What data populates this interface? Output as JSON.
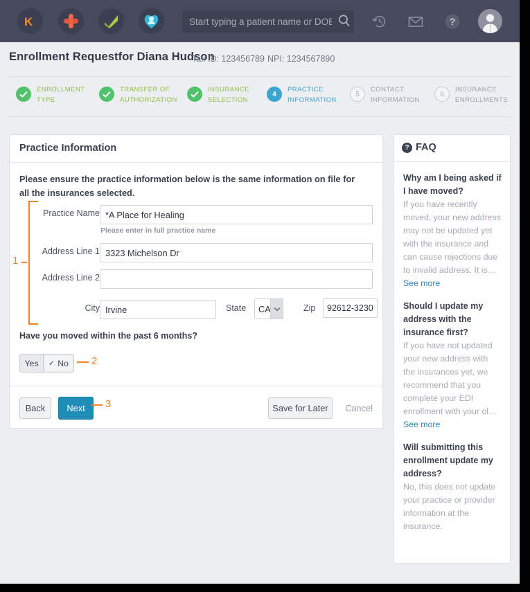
{
  "topbar": {
    "logos": [
      {
        "name": "kareo-k-logo",
        "label": "K"
      },
      {
        "name": "medical-cross-logo",
        "label": ""
      },
      {
        "name": "green-check-logo",
        "label": ""
      },
      {
        "name": "patient-heart-logo",
        "label": ""
      }
    ],
    "search": {
      "placeholder": "Start typing a patient name or DOB",
      "value": ""
    },
    "icons": [
      {
        "name": "history-icon",
        "label": "History"
      },
      {
        "name": "mail-icon",
        "label": "Messages"
      },
      {
        "name": "help-icon",
        "label": "Help"
      },
      {
        "name": "avatar",
        "label": "Account"
      }
    ]
  },
  "header": {
    "title": "Enrollment Requestfor Diana Hudson",
    "tax_id": "Tax ID: 123456789",
    "npi": "NPI: 1234567890"
  },
  "stepper": {
    "steps": [
      {
        "num": "1",
        "mark": "✓",
        "line1": "ENROLLMENT",
        "line2": "TYPE",
        "state": "done"
      },
      {
        "num": "2",
        "mark": "✓",
        "line1": "TRANSFER OF",
        "line2": "AUTHORIZATION",
        "state": "done"
      },
      {
        "num": "3",
        "mark": "✓",
        "line1": "INSURANCE",
        "line2": "SELECTION",
        "state": "done"
      },
      {
        "num": "4",
        "mark": "4",
        "line1": "PRACTICE",
        "line2": "INFORMATION",
        "state": "active"
      },
      {
        "num": "5",
        "mark": "5",
        "line1": "CONTACT",
        "line2": "INFORMATION",
        "state": "todo"
      },
      {
        "num": "6",
        "mark": "6",
        "line1": "INSURANCE",
        "line2": "ENROLLMENTS",
        "state": "todo"
      }
    ]
  },
  "main": {
    "card_title": "Practice Information",
    "intro": "Please ensure the practice information below is the same information on file for all the insurances selected.",
    "fields": {
      "practice_name": {
        "label": "Practice Name",
        "value": "*A Place for Healing",
        "placeholder": "",
        "hint": "Please enter in full practice name"
      },
      "address1": {
        "label": "Address Line 1",
        "value": "3323 Michelson Dr",
        "placeholder": ""
      },
      "address2": {
        "label": "Address Line 2",
        "value": "",
        "placeholder": ""
      },
      "city": {
        "label": "City",
        "value": "Irvine",
        "placeholder": ""
      },
      "state": {
        "label": "State",
        "value": "CA",
        "options": [
          "CA"
        ]
      },
      "zip": {
        "label": "Zip",
        "value": "92612-3230",
        "placeholder": ""
      }
    },
    "moved_question": "Have you moved within the past 6 months?",
    "toggle": {
      "yes_label": "Yes",
      "no_label": "No",
      "check_mark": "✓",
      "selected": "No"
    },
    "buttons": {
      "back": "Back",
      "next": "Next",
      "save_for_later": "Save for Later",
      "cancel": "Cancel"
    }
  },
  "annotations": [
    {
      "name": "annotation-1",
      "label": "1"
    },
    {
      "name": "annotation-2",
      "label": "2"
    },
    {
      "name": "annotation-3",
      "label": "3"
    }
  ],
  "faq": {
    "icon_glyph": "?",
    "title": "FAQ",
    "see_more_label": "See more",
    "items": [
      {
        "question": "Why am I being asked if I have moved?",
        "answer": "If you have recently moved, your new address may not be updated yet with the insurance and can cause rejections due to invalid address. It is…",
        "has_see_more": true
      },
      {
        "question": "Should I update my address with the insurance first?",
        "answer": "If you have not updated your new address with the insurances yet, we recommend that you complete your EDI enrollment with your ol…",
        "has_see_more": true
      },
      {
        "question": "Will submitting this enrollment update my address?",
        "answer": "No, this does not update your practice or provider information at the insurance.",
        "has_see_more": false
      }
    ]
  },
  "colors": {
    "topbar_bg": "#464a5c",
    "page_bg": "#edeef2",
    "accent_blue": "#1f8db5",
    "step_active": "#3ba4cf",
    "step_done_green": "#4fc26b",
    "step_done_text": "#8fbf3f",
    "annotation_orange": "#ef8420",
    "link_blue": "#2f83b5"
  }
}
